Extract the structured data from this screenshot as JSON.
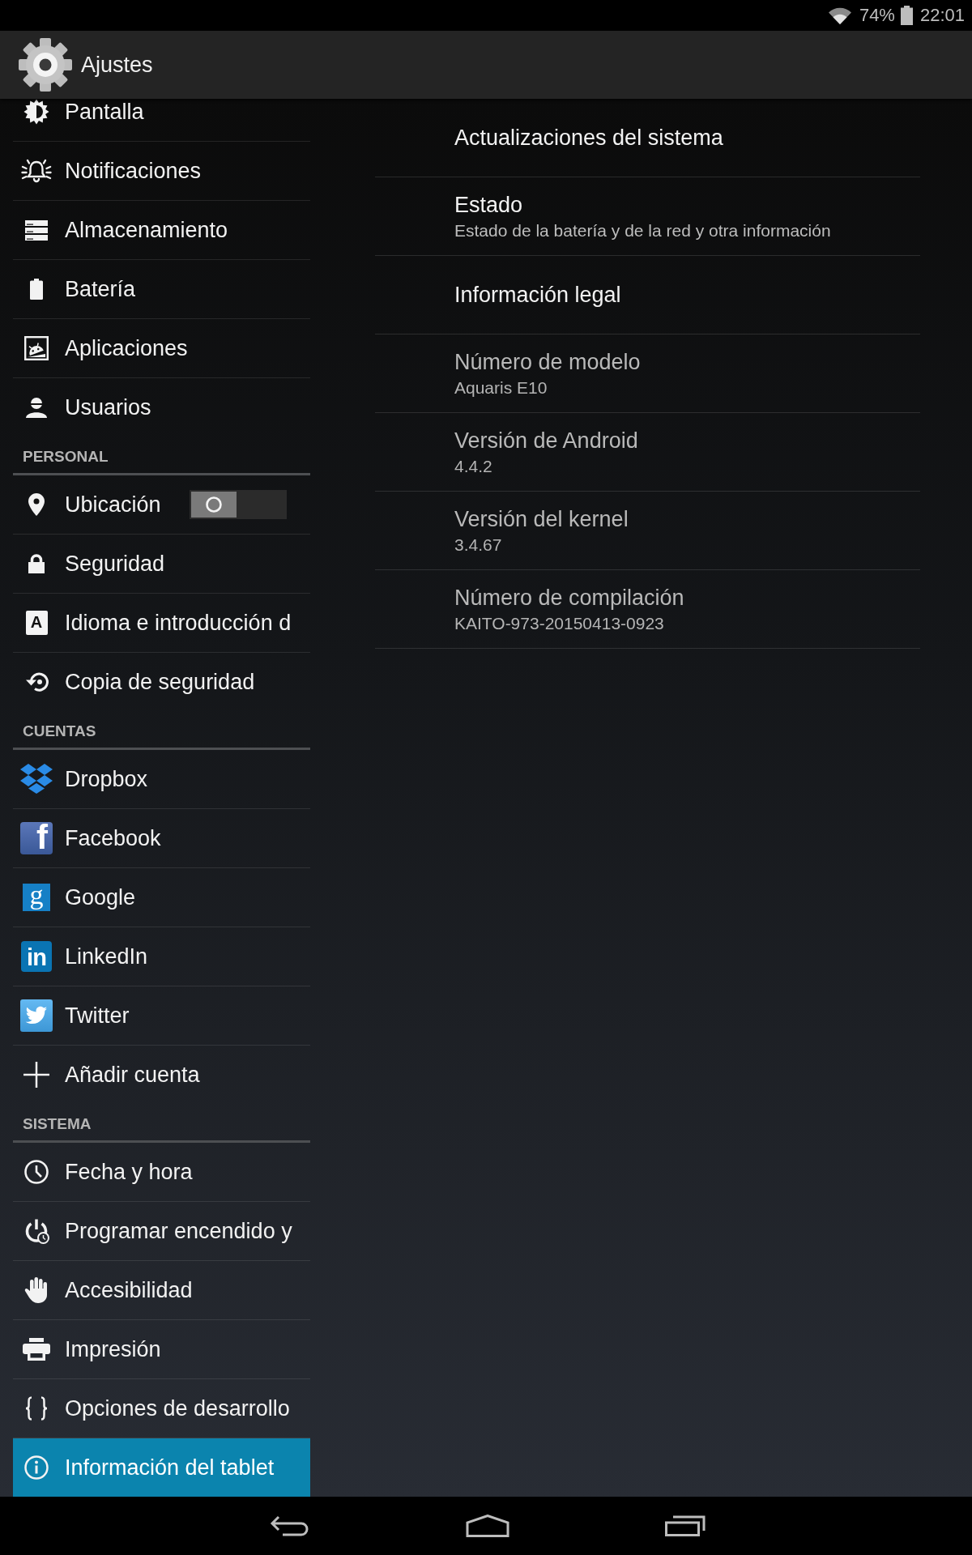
{
  "status_bar": {
    "battery": "74%",
    "time": "22:01"
  },
  "action_bar": {
    "title": "Ajustes"
  },
  "sidebar": {
    "sections": [
      {
        "items": [
          {
            "label": "Pantalla",
            "kind": "icon",
            "selected": false
          },
          {
            "label": "Notificaciones",
            "kind": "icon",
            "selected": false
          },
          {
            "label": "Almacenamiento",
            "kind": "icon",
            "selected": false
          },
          {
            "label": "Batería",
            "kind": "icon",
            "selected": false
          },
          {
            "label": "Aplicaciones",
            "kind": "icon",
            "selected": false
          },
          {
            "label": "Usuarios",
            "kind": "icon",
            "selected": false
          }
        ]
      },
      {
        "header": "PERSONAL",
        "items": [
          {
            "label": "Ubicación",
            "kind": "switch",
            "on": false,
            "selected": false
          },
          {
            "label": "Seguridad",
            "kind": "icon",
            "selected": false
          },
          {
            "label": "Idioma e introducción d",
            "kind": "logo",
            "logo": "A",
            "selected": false
          },
          {
            "label": "Copia de seguridad",
            "kind": "icon",
            "selected": false
          }
        ]
      },
      {
        "header": "CUENTAS",
        "items": [
          {
            "label": "Dropbox",
            "kind": "icon",
            "selected": false
          },
          {
            "label": "Facebook",
            "kind": "logo",
            "logo": "f",
            "selected": false
          },
          {
            "label": "Google",
            "kind": "logo",
            "logo": "g",
            "selected": false
          },
          {
            "label": "LinkedIn",
            "kind": "logo",
            "logo": "in",
            "selected": false
          },
          {
            "label": "Twitter",
            "kind": "icon",
            "selected": false
          },
          {
            "label": "Añadir cuenta",
            "kind": "icon",
            "selected": false
          }
        ]
      },
      {
        "header": "SISTEMA",
        "items": [
          {
            "label": "Fecha y hora",
            "kind": "icon",
            "selected": false
          },
          {
            "label": "Programar encendido y",
            "kind": "icon",
            "selected": false
          },
          {
            "label": "Accesibilidad",
            "kind": "icon",
            "selected": false
          },
          {
            "label": "Impresión",
            "kind": "icon",
            "selected": false
          },
          {
            "label": "Opciones de desarrollo",
            "kind": "icon",
            "selected": false
          },
          {
            "label": "Información del tablet",
            "kind": "icon",
            "selected": true
          }
        ]
      }
    ]
  },
  "details": {
    "rows": [
      {
        "title": "Actualizaciones del sistema",
        "disabled": false
      },
      {
        "title": "Estado",
        "summary": "Estado de la batería y de la red y otra información",
        "disabled": false
      },
      {
        "title": "Información legal",
        "disabled": false
      },
      {
        "title": "Número de modelo",
        "summary": "Aquaris E10",
        "disabled": true
      },
      {
        "title": "Versión de Android",
        "summary": "4.4.2",
        "disabled": true
      },
      {
        "title": "Versión del kernel",
        "summary": "3.4.67",
        "disabled": true
      },
      {
        "title": "Número de compilación",
        "summary": "KAITO-973-20150413-0923",
        "disabled": true
      }
    ]
  }
}
